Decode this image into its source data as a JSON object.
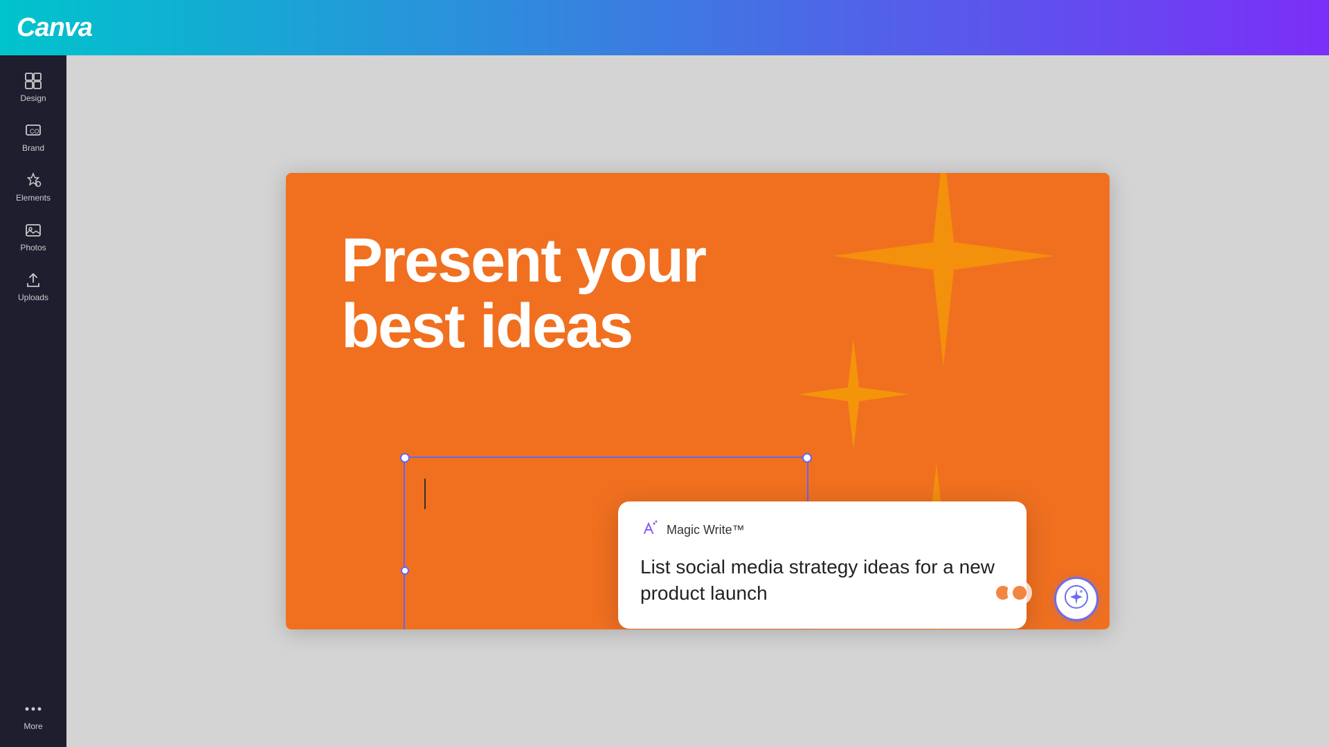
{
  "header": {
    "logo_text": "Canva"
  },
  "sidebar": {
    "items": [
      {
        "id": "design",
        "label": "Design",
        "icon": "design-icon"
      },
      {
        "id": "brand",
        "label": "Brand",
        "icon": "brand-icon"
      },
      {
        "id": "elements",
        "label": "Elements",
        "icon": "elements-icon"
      },
      {
        "id": "photos",
        "label": "Photos",
        "icon": "photos-icon"
      },
      {
        "id": "uploads",
        "label": "Uploads",
        "icon": "uploads-icon"
      },
      {
        "id": "more",
        "label": "More",
        "icon": "more-icon"
      }
    ]
  },
  "canvas": {
    "slide": {
      "headline_line1": "Present your",
      "headline_line2": "best ideas",
      "background_color": "#f07020"
    },
    "magic_write": {
      "title": "Magic Write™",
      "prompt_text": "List social media strategy ideas for a new product launch"
    }
  }
}
